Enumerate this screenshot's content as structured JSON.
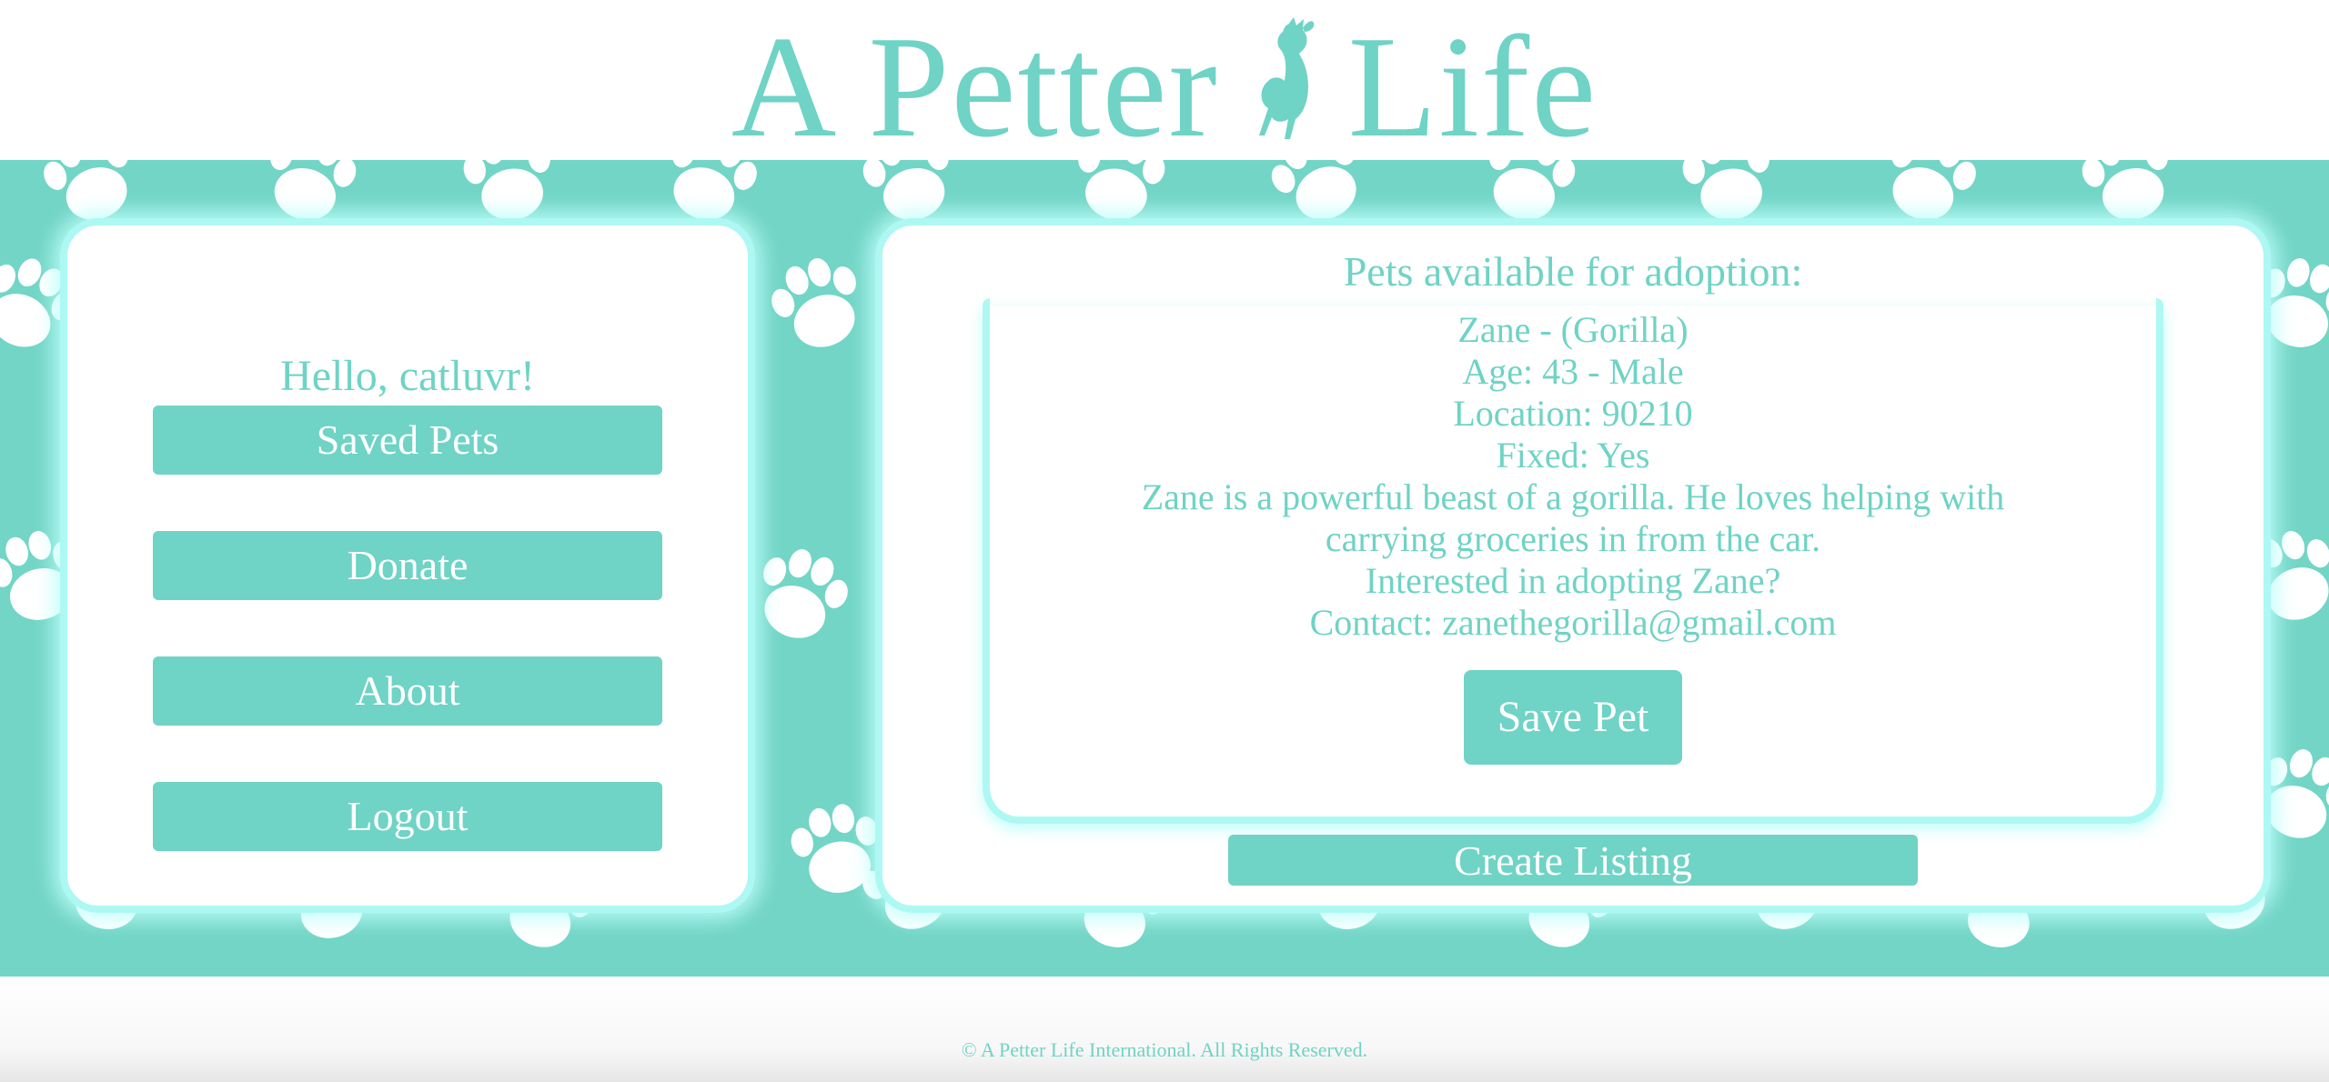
{
  "brand": {
    "title": "A Petter Life",
    "title_before": "A Petter",
    "title_after": "Life",
    "primary_color": "#6fd3c5",
    "glow_color": "#aef8f3"
  },
  "sidebar": {
    "greeting": "Hello, catluvr!",
    "buttons": [
      {
        "label": "Saved Pets"
      },
      {
        "label": "Donate"
      },
      {
        "label": "About"
      },
      {
        "label": "Logout"
      }
    ]
  },
  "main": {
    "heading": "Pets available for adoption:",
    "pet": {
      "name_line": "Zane - (Gorilla)",
      "age_line": "Age: 43 - Male",
      "location_line": "Location: 90210",
      "fixed_line": "Fixed: Yes",
      "description_line1": "Zane is a powerful beast of a gorilla. He loves helping with",
      "description_line2": "carrying groceries in from the car.",
      "interest_line": "Interested in adopting Zane?",
      "contact_line": "Contact: zanethegorilla@gmail.com",
      "save_label": "Save Pet"
    },
    "create_listing_label": "Create Listing"
  },
  "footer": {
    "copyright": "© A Petter Life International. All Rights Reserved."
  },
  "icons": {
    "logo_figure": "cat-icon",
    "background_pattern": "paw-print-icon"
  }
}
